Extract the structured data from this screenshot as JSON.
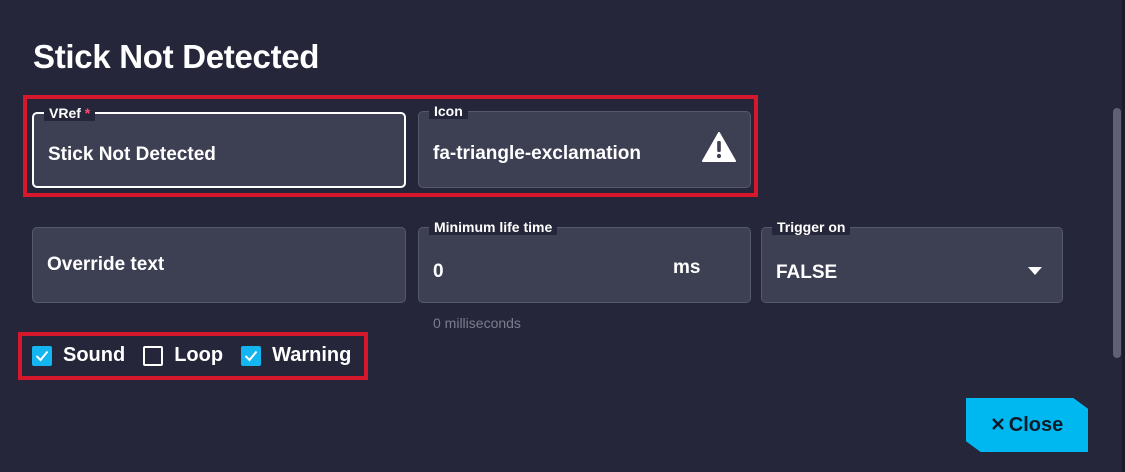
{
  "dialog": {
    "title": "Stick Not Detected"
  },
  "fields": {
    "vref": {
      "label": "VRef",
      "required_mark": "*",
      "value": "Stick Not Detected"
    },
    "icon": {
      "label": "Icon",
      "value": "fa-triangle-exclamation",
      "icon_name": "triangle-exclamation-icon"
    },
    "override_text": {
      "placeholder": "Override text",
      "value": ""
    },
    "min_life_time": {
      "label": "Minimum life time",
      "value": "0",
      "suffix": "ms",
      "hint": "0 milliseconds"
    },
    "trigger_on": {
      "label": "Trigger on",
      "value": "FALSE"
    }
  },
  "checkboxes": [
    {
      "label": "Sound",
      "checked": true
    },
    {
      "label": "Loop",
      "checked": false
    },
    {
      "label": "Warning",
      "checked": true
    }
  ],
  "actions": {
    "close_label": "Close"
  },
  "colors": {
    "background": "#252639",
    "field_bg": "#3d3f53",
    "accent": "#00b8f0",
    "highlight": "#d5182b",
    "required": "#ff4d6a"
  }
}
